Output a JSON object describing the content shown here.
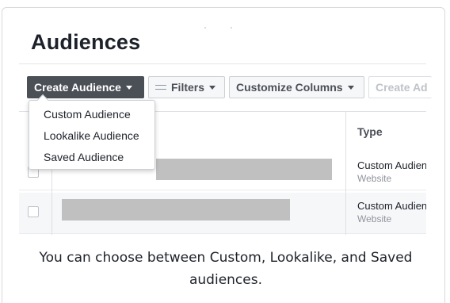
{
  "page": {
    "title": "Audiences"
  },
  "toolbar": {
    "create_audience_label": "Create Audience",
    "filters_label": "Filters",
    "customize_columns_label": "Customize Columns",
    "create_ad_label": "Create Ad"
  },
  "dropdown": {
    "items": [
      {
        "label": "Custom Audience"
      },
      {
        "label": "Lookalike Audience"
      },
      {
        "label": "Saved Audience"
      }
    ]
  },
  "table": {
    "headers": {
      "type": "Type"
    },
    "rows": [
      {
        "type": "Custom Audience",
        "subtype": "Website"
      },
      {
        "type": "Custom Audience",
        "subtype": "Website"
      }
    ]
  },
  "caption": "You can choose between Custom, Lookalike, and Saved audiences.",
  "colors": {
    "primary_button": "#4b4f56",
    "redaction": "#c0c0c0",
    "border": "#dddfe2"
  },
  "icons": {
    "filters": "sliders-icon",
    "caret": "caret-down-icon"
  }
}
